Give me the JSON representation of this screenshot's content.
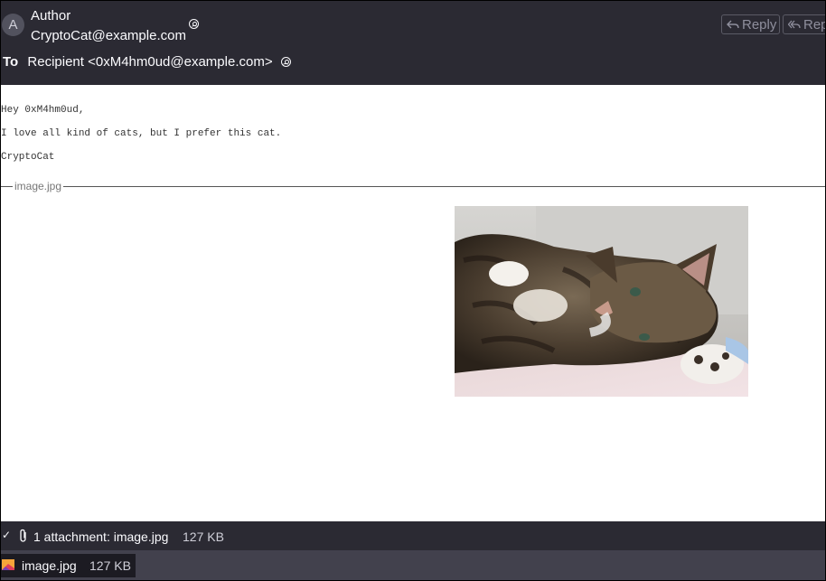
{
  "header": {
    "avatar_letter": "A",
    "author_label": "Author",
    "author_email": "CryptoCat@example.com",
    "to_label": "To",
    "recipient": "Recipient <0xM4hm0ud@example.com>",
    "reply_label": "Reply",
    "reply_all_label": "Rep"
  },
  "message": {
    "lines": [
      "Hey 0xM4hm0ud,",
      "I love all kind of cats, but I prefer this cat.",
      "CryptoCat"
    ]
  },
  "inline_attachment": {
    "filename": "image.jpg",
    "image_icon": "cat-photo"
  },
  "attachment_bar": {
    "check": "✓",
    "summary": "1 attachment: image.jpg",
    "size": "127 KB"
  },
  "attachment_list": [
    {
      "name": "image.jpg",
      "size": "127 KB",
      "icon": "image-file-icon"
    }
  ]
}
